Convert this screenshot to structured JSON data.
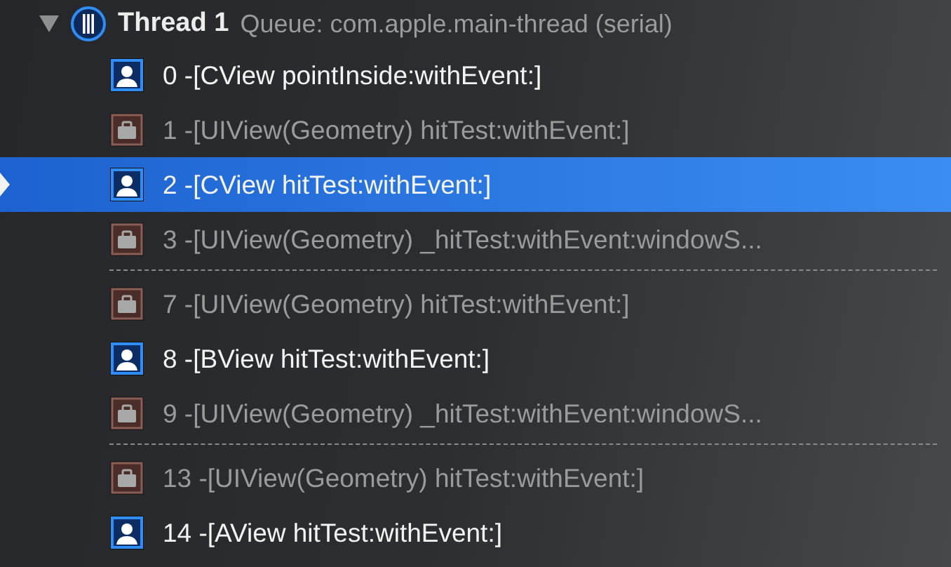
{
  "thread": {
    "expanded": true,
    "title": "Thread 1",
    "queue": "Queue: com.apple.main-thread (serial)"
  },
  "frames": [
    {
      "kind": "user",
      "text": "0 -[CView pointInside:withEvent:]",
      "selected": false
    },
    {
      "kind": "system",
      "text": "1 -[UIView(Geometry) hitTest:withEvent:]",
      "selected": false
    },
    {
      "kind": "user",
      "text": "2 -[CView hitTest:withEvent:]",
      "selected": true
    },
    {
      "kind": "system",
      "text": "3 -[UIView(Geometry) _hitTest:withEvent:windowS...",
      "selected": false
    },
    {
      "kind": "separator"
    },
    {
      "kind": "system",
      "text": "7 -[UIView(Geometry) hitTest:withEvent:]",
      "selected": false
    },
    {
      "kind": "user",
      "text": "8 -[BView hitTest:withEvent:]",
      "selected": false
    },
    {
      "kind": "system",
      "text": "9 -[UIView(Geometry) _hitTest:withEvent:windowS...",
      "selected": false
    },
    {
      "kind": "separator"
    },
    {
      "kind": "system",
      "text": "13 -[UIView(Geometry) hitTest:withEvent:]",
      "selected": false
    },
    {
      "kind": "user",
      "text": "14 -[AView hitTest:withEvent:]",
      "selected": false
    }
  ]
}
